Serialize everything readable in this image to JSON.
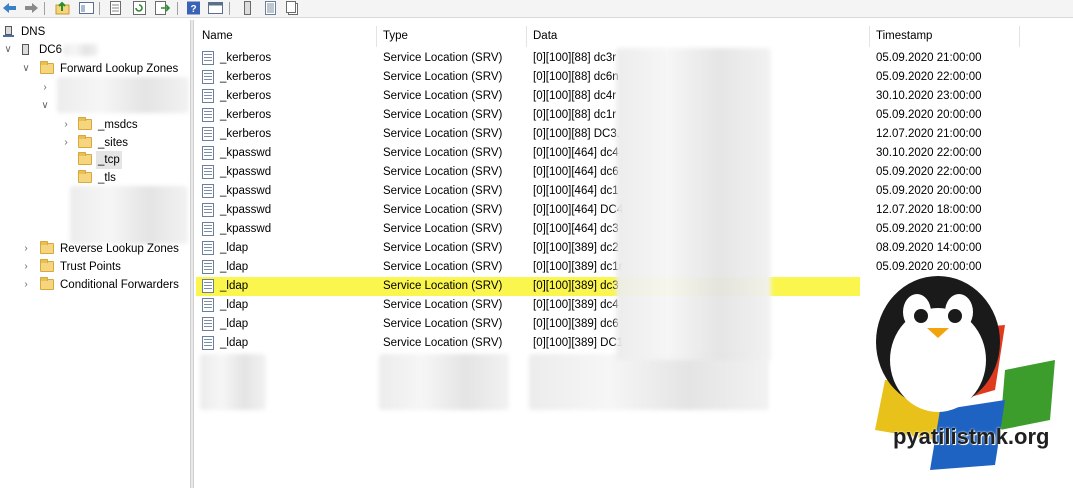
{
  "toolbar": {
    "icons": [
      "back-icon",
      "forward-icon",
      "up-folder-icon",
      "show-hide-tree-icon",
      "properties-icon",
      "refresh-icon",
      "export-list-icon",
      "help-icon",
      "console-view-icon",
      "server-icon",
      "zone-icon",
      "record-icon"
    ]
  },
  "tree": {
    "root": "DNS",
    "server": "DC6",
    "forward": "Forward Lookup Zones",
    "msdcs": "_msdcs",
    "sites": "_sites",
    "tcp": "_tcp",
    "tls": "_tls",
    "reverse": "Reverse Lookup Zones",
    "trust": "Trust Points",
    "conditional": "Conditional Forwarders"
  },
  "columns": {
    "name": "Name",
    "type": "Type",
    "data": "Data",
    "timestamp": "Timestamp"
  },
  "records": [
    {
      "name": "_kerberos",
      "type": "Service Location (SRV)",
      "data": "[0][100][88] dc3r",
      "timestamp": "05.09.2020 21:00:00"
    },
    {
      "name": "_kerberos",
      "type": "Service Location (SRV)",
      "data": "[0][100][88] dc6n",
      "timestamp": "05.09.2020 22:00:00"
    },
    {
      "name": "_kerberos",
      "type": "Service Location (SRV)",
      "data": "[0][100][88] dc4r",
      "timestamp": "30.10.2020 23:00:00"
    },
    {
      "name": "_kerberos",
      "type": "Service Location (SRV)",
      "data": "[0][100][88] dc1r",
      "timestamp": "05.09.2020 20:00:00"
    },
    {
      "name": "_kerberos",
      "type": "Service Location (SRV)",
      "data": "[0][100][88] DC3.",
      "timestamp": "12.07.2020 21:00:00"
    },
    {
      "name": "_kpasswd",
      "type": "Service Location (SRV)",
      "data": "[0][100][464] dc4",
      "timestamp": "30.10.2020 22:00:00"
    },
    {
      "name": "_kpasswd",
      "type": "Service Location (SRV)",
      "data": "[0][100][464] dc6",
      "timestamp": "05.09.2020 22:00:00"
    },
    {
      "name": "_kpasswd",
      "type": "Service Location (SRV)",
      "data": "[0][100][464] dc1",
      "timestamp": "05.09.2020 20:00:00"
    },
    {
      "name": "_kpasswd",
      "type": "Service Location (SRV)",
      "data": "[0][100][464] DC4",
      "timestamp": "12.07.2020 18:00:00"
    },
    {
      "name": "_kpasswd",
      "type": "Service Location (SRV)",
      "data": "[0][100][464] dc3",
      "timestamp": "05.09.2020 21:00:00"
    },
    {
      "name": "_ldap",
      "type": "Service Location (SRV)",
      "data": "[0][100][389] dc2",
      "timestamp": "08.09.2020 14:00:00"
    },
    {
      "name": "_ldap",
      "type": "Service Location (SRV)",
      "data": "[0][100][389] dc1r",
      "timestamp": "05.09.2020 20:00:00"
    },
    {
      "name": "_ldap",
      "type": "Service Location (SRV)",
      "data": "[0][100][389] dc3",
      "timestamp": ""
    },
    {
      "name": "_ldap",
      "type": "Service Location (SRV)",
      "data": "[0][100][389] dc4",
      "timestamp": ""
    },
    {
      "name": "_ldap",
      "type": "Service Location (SRV)",
      "data": "[0][100][389] dc6",
      "timestamp": ""
    },
    {
      "name": "_ldap",
      "type": "Service Location (SRV)",
      "data": "[0][100][389] DC1",
      "timestamp": ""
    }
  ],
  "highlight_color": "#faf64e",
  "watermark": "pyatilistmk.org"
}
